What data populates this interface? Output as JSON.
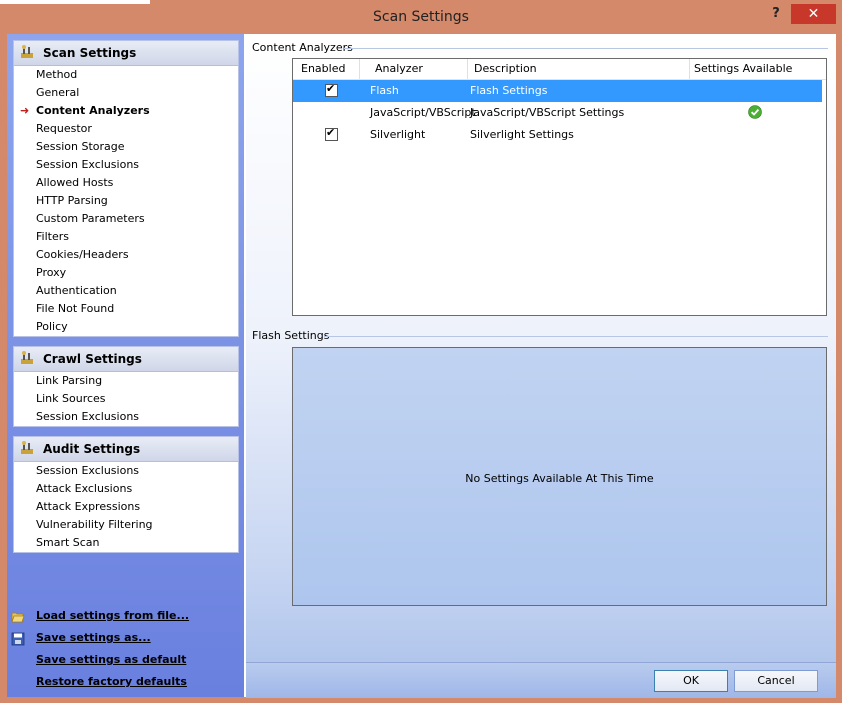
{
  "window": {
    "title": "Scan Settings",
    "help_label": "?",
    "close_label": "✕"
  },
  "sidebar": {
    "groups": [
      {
        "header": "Scan Settings",
        "items": [
          {
            "label": "Method"
          },
          {
            "label": "General"
          },
          {
            "label": "Content Analyzers"
          },
          {
            "label": "Requestor"
          },
          {
            "label": "Session Storage"
          },
          {
            "label": "Session Exclusions"
          },
          {
            "label": "Allowed Hosts"
          },
          {
            "label": "HTTP Parsing"
          },
          {
            "label": "Custom Parameters"
          },
          {
            "label": "Filters"
          },
          {
            "label": "Cookies/Headers"
          },
          {
            "label": "Proxy"
          },
          {
            "label": "Authentication"
          },
          {
            "label": "File Not Found"
          },
          {
            "label": "Policy"
          }
        ]
      },
      {
        "header": "Crawl Settings",
        "items": [
          {
            "label": "Link Parsing"
          },
          {
            "label": "Link Sources"
          },
          {
            "label": "Session Exclusions"
          }
        ]
      },
      {
        "header": "Audit Settings",
        "items": [
          {
            "label": "Session Exclusions"
          },
          {
            "label": "Attack Exclusions"
          },
          {
            "label": "Attack Expressions"
          },
          {
            "label": "Vulnerability Filtering"
          },
          {
            "label": "Smart Scan"
          }
        ]
      }
    ],
    "links": [
      {
        "label": "Load settings from file...",
        "icon": "folder-open-icon"
      },
      {
        "label": "Save settings as...",
        "icon": "floppy-disk-icon"
      },
      {
        "label": "Save settings as default",
        "icon": ""
      },
      {
        "label": "Restore factory defaults",
        "icon": ""
      }
    ]
  },
  "content": {
    "analyzers_section_label": "Content Analyzers",
    "columns": [
      "Enabled",
      "Analyzer",
      "Description",
      "Settings Available"
    ],
    "rows": [
      {
        "enabled": true,
        "analyzer": "Flash",
        "description": "Flash Settings",
        "settings_available": false,
        "selected": true
      },
      {
        "enabled": false,
        "analyzer": "JavaScript/VBScript",
        "description": "JavaScript/VBScript Settings",
        "settings_available": true,
        "selected": false
      },
      {
        "enabled": true,
        "analyzer": "Silverlight",
        "description": "Silverlight Settings",
        "settings_available": false,
        "selected": false
      }
    ],
    "flash_section_label": "Flash Settings",
    "flash_message": "No Settings Available At This Time"
  },
  "buttons": {
    "ok": "OK",
    "cancel": "Cancel"
  },
  "colors": {
    "accent_selected_row": "#3399ff",
    "close_button": "#c7382b",
    "title_bar": "#d4896a"
  }
}
